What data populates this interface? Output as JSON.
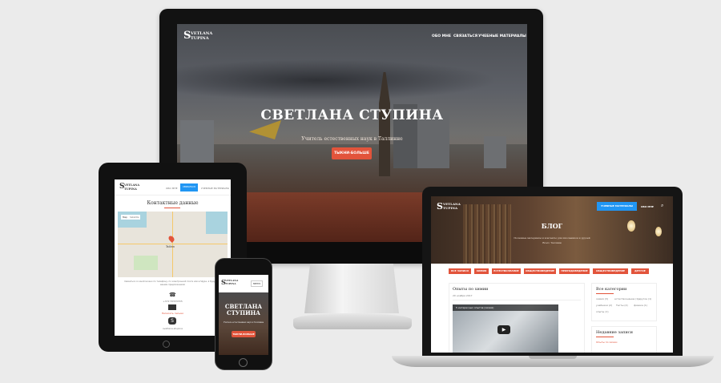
{
  "imac": {
    "logo_initial": "S",
    "logo_line1": "VETLANA",
    "logo_line2": "TUPINA",
    "nav": [
      "ОБО МНЕ",
      "СВЯЗАТЬСЯ",
      "УЧЕБНЫЕ МАТЕРИАЛЫ"
    ],
    "hero_title": "СВЕТЛАНА СТУПИНА",
    "hero_subtitle": "Учитель естественных наук в Таллинне",
    "hero_button": "ТЫКНИ-БОЛЬШЕ"
  },
  "tablet": {
    "logo_initial": "S",
    "logo_line1": "VETLANA",
    "logo_line2": "TUPINA",
    "nav": [
      "ОБО МНЕ",
      "СВЯЗАТЬСЯ",
      "УЧЕБНЫЕ МАТЕРИАЛЫ"
    ],
    "heading": "Контактные данные",
    "map_tabs": [
      "Map",
      "Satellite"
    ],
    "map_city": "Tallinn",
    "intro": "Связаться со мной можно по телефону, по электронной почте или в Skype, я буду рада вашим предложениям",
    "phone": "+372 55555555",
    "email": "Написать письмо",
    "skype": "svetlana.stupina"
  },
  "laptop": {
    "logo_initial": "S",
    "logo_line1": "VETLANA",
    "logo_line2": "TUPINA",
    "nav_button": "УЧЕБНЫЕ МАТЕРИАЛЫ",
    "nav_link": "ОБО МНЕ",
    "hero_title": "БЛОГ",
    "hero_subtitle": "Полезные материалы и контакты для школьников и друзей",
    "hero_subtitle2": "Всего Таллинн",
    "categories": [
      "ВСЕ ЗАПИСИ",
      "ХИМИЯ",
      "ЕСТЕСТВОЗНАНИЕ",
      "ОБЩЕСТВОВЕДЕНИЕ",
      "ПРИРОДОВЕДЕНИЕ",
      "ОБЩЕСТВОВЕДЕНИЕ",
      "ДРУГОЕ"
    ],
    "post_title": "Опыты по химии",
    "post_date": "20 ноября 2017",
    "video_title": "5 интересных опытов (химия)",
    "sidebar_title": "Все категории",
    "sidebar_tags": [
      "химия (3)",
      "естествознание (1)",
      "другое (1)",
      "учебники (2)",
      "Тесты (2)",
      "физика (1)",
      "опыты (1)"
    ],
    "recent_title": "Недавние записи",
    "recent_item": "Опыты по химии"
  },
  "phone": {
    "logo_initial": "S",
    "logo_line1": "VETLANA",
    "logo_line2": "TUPINA",
    "menu": "МЕНЮ",
    "hero_title_line1": "СВЕТЛАНА",
    "hero_title_line2": "СТУПИНА",
    "hero_subtitle": "Учитель естественных наук в Таллинне",
    "hero_button": "ТЫКНИ-БОЛЬШЕ"
  },
  "colors": {
    "accent": "#e2543b",
    "blue": "#2196f3",
    "device_dark": "#121212"
  }
}
